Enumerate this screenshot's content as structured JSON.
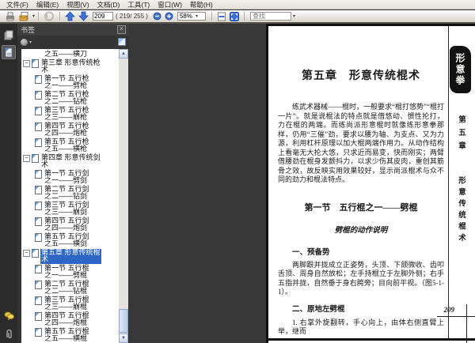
{
  "menu": {
    "items": [
      "文件(F)",
      "编辑(E)",
      "视图(V)",
      "文档(D)",
      "工具(T)",
      "窗口(W)",
      "帮助(H)"
    ]
  },
  "toolbar": {
    "page_field": "209",
    "page_count": "( 219/ 255 )",
    "zoom_level": "58%",
    "find_placeholder": "查找"
  },
  "sidebar": {
    "title": "书签",
    "close_label": "×",
    "tree": [
      {
        "label": "之五——横刀",
        "depth": 1,
        "expander": false,
        "icon": false,
        "selected": false
      },
      {
        "label": "第三章 形意传统枪\n术",
        "depth": 0,
        "expander": true,
        "icon": true,
        "selected": false
      },
      {
        "label": "第一节 五行枪\n之一——劈枪",
        "depth": 1,
        "expander": false,
        "icon": true,
        "selected": false
      },
      {
        "label": "第二节 五行枪\n之二——钻枪",
        "depth": 1,
        "expander": false,
        "icon": true,
        "selected": false
      },
      {
        "label": "第三节 五行枪\n之三——崩枪",
        "depth": 1,
        "expander": false,
        "icon": true,
        "selected": false
      },
      {
        "label": "第四节 五行枪\n之四——炮枪",
        "depth": 1,
        "expander": false,
        "icon": true,
        "selected": false
      },
      {
        "label": "第五节 五行枪\n之五——横枪",
        "depth": 1,
        "expander": false,
        "icon": true,
        "selected": false
      },
      {
        "label": "第四章 形意传统剑\n术",
        "depth": 0,
        "expander": true,
        "icon": true,
        "selected": false
      },
      {
        "label": "第一节 五行剑\n之一——劈剑",
        "depth": 1,
        "expander": false,
        "icon": true,
        "selected": false
      },
      {
        "label": "第二节 五行剑\n之二——钻剑",
        "depth": 1,
        "expander": false,
        "icon": true,
        "selected": false
      },
      {
        "label": "第三节 五行剑\n之三——崩剑",
        "depth": 1,
        "expander": false,
        "icon": true,
        "selected": false
      },
      {
        "label": "第四节 五行剑\n之四——炮剑",
        "depth": 1,
        "expander": false,
        "icon": true,
        "selected": false
      },
      {
        "label": "第五节 五行剑\n之五——横剑",
        "depth": 1,
        "expander": false,
        "icon": true,
        "selected": false
      },
      {
        "label": "第五章 形意传统棍\n术",
        "depth": 0,
        "expander": true,
        "icon": true,
        "selected": true
      },
      {
        "label": "第一节 五行棍\n之一——劈棍",
        "depth": 1,
        "expander": false,
        "icon": true,
        "selected": false
      },
      {
        "label": "第二节 五行棍\n之二——钻棍",
        "depth": 1,
        "expander": false,
        "icon": true,
        "selected": false
      },
      {
        "label": "第三节 五行棍\n之三——崩棍",
        "depth": 1,
        "expander": false,
        "icon": true,
        "selected": false
      },
      {
        "label": "第四节 五行棍\n之四——炮棍",
        "depth": 1,
        "expander": false,
        "icon": true,
        "selected": false
      },
      {
        "label": "第五节 五行棍\n之五——横棍",
        "depth": 1,
        "expander": false,
        "icon": true,
        "selected": false
      }
    ]
  },
  "document": {
    "chapter_title": "第五章　形意传统棍术",
    "paragraph1": "练武术器械——棍时，一般要求“棍打悠势”“棍打一片”。就是说棍法的特点就是借悠动、惯性抡打，力在棍的两端。而练尚派形意棍时就像练形意拳那样，仍用“三催”劲，要求以腰为轴、为支点、又为力源，利用杠杆原理以加大棍两端作用力。从动作结构上看毫无大抡大悠，只求近而易变，快而刚实；两臂借腰劲在棍身发颤抖力，以求少伤其皮肉，重创其筋骨之效，故反映实用效果较好，显示尚派棍术与众不同的劲力和棍法特点。",
    "section_title": "第一节　五行棍之一——劈棍",
    "subsection_title": "劈棍的动作说明",
    "heading1": "一、预备势",
    "paragraph2": "两脚跟并拢成立正姿势，头顶、下颌微收、齿叩舌顶、周身自然放松；左手持棍立于左脚外侧；右手五指并拢，自然垂于身右胯旁；目向前平视。（图5-1-1）。",
    "heading2": "二、原地左劈棍",
    "paragraph3": "1. 右掌外旋翻转，手心向上，由体右侧直臂上举，继而",
    "page_number": "209",
    "margin_chapter": "第五章",
    "margin_title": "形意传统棍术",
    "seal_text": "形意拳"
  },
  "colors": {
    "selection_blue": "#2e66c5",
    "panel_dark": "#333333",
    "toolbar_accent_blue": "#3f74d8",
    "page_background": "#ffffff"
  }
}
